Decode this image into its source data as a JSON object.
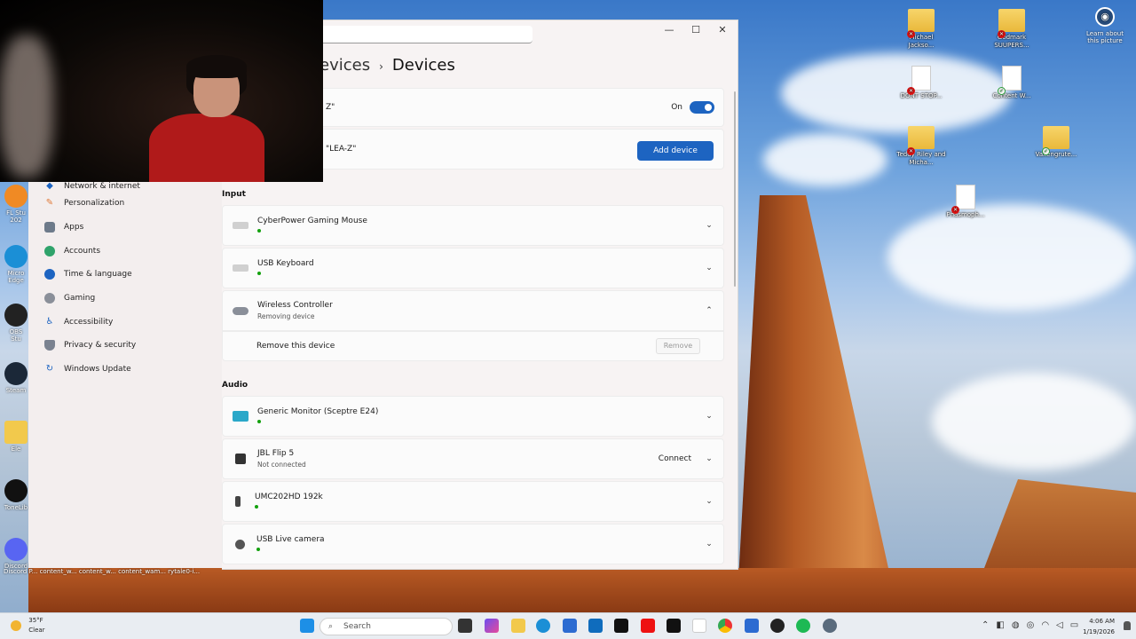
{
  "desktop": {
    "icons": [
      {
        "label": "Michael Jackso...",
        "type": "folder",
        "status": "x"
      },
      {
        "label": "Godmark SUUPERS...",
        "type": "folder",
        "status": "x"
      },
      {
        "label": "DONT STOP...",
        "type": "file",
        "status": "x"
      },
      {
        "label": "Content W...",
        "type": "file",
        "status": "ok"
      },
      {
        "label": "Teddy Riley and Micha...",
        "type": "folder",
        "status": "x"
      },
      {
        "label": "Vaxengrute...",
        "type": "folder",
        "status": "ok"
      },
      {
        "label": "Phasmoph...",
        "type": "file",
        "status": "x"
      }
    ],
    "spotlight_label": "Learn about this picture",
    "left_shortcuts": [
      "FL Stu 202",
      "Micro Edge",
      "OBS Stu",
      "Steam",
      "Ele",
      "ToneLib",
      "Discord"
    ],
    "bottom_labels": "Discord P... content_w... content_w... content_wam... rytale0-i..."
  },
  "settings": {
    "breadcrumb_prev": "evices",
    "breadcrumb_sep": "›",
    "breadcrumb_current": "Devices",
    "window_controls": [
      "—",
      "☐",
      "✕"
    ],
    "bluetooth_row": {
      "subtitle": "Z\"",
      "toggle_label": "On"
    },
    "add_row": {
      "subtitle": "\"LEA-Z\"",
      "button": "Add device"
    },
    "sections": [
      {
        "title": "Input",
        "devices": [
          {
            "name": "CyberPower Gaming Mouse",
            "status": "",
            "icon": "keyboard-icon"
          },
          {
            "name": "USB Keyboard",
            "status": "",
            "icon": "keyboard-icon"
          },
          {
            "name": "Wireless Controller",
            "status": "Removing device",
            "icon": "gamepad-icon",
            "expanded": true
          }
        ]
      },
      {
        "title": "Audio",
        "devices": [
          {
            "name": "Generic Monitor (Sceptre E24)",
            "status": "",
            "icon": "monitor-icon"
          },
          {
            "name": "JBL Flip 5",
            "status": "Not connected",
            "icon": "speaker-icon",
            "action": "Connect"
          },
          {
            "name": "UMC202HD 192k",
            "status": "",
            "icon": "speaker-icon"
          },
          {
            "name": "USB Live camera",
            "status": "",
            "icon": "webcam-icon"
          }
        ]
      }
    ],
    "remove_row": {
      "label": "Remove this device",
      "button": "Remove"
    }
  },
  "sidebar": {
    "items": [
      {
        "label": "Network & internet",
        "icon": "wifi-icon"
      },
      {
        "label": "Personalization",
        "icon": "brush-icon"
      },
      {
        "label": "Apps",
        "icon": "apps-icon"
      },
      {
        "label": "Accounts",
        "icon": "account-icon"
      },
      {
        "label": "Time & language",
        "icon": "globe-icon"
      },
      {
        "label": "Gaming",
        "icon": "gamepad-icon"
      },
      {
        "label": "Accessibility",
        "icon": "accessibility-icon"
      },
      {
        "label": "Privacy & security",
        "icon": "shield-icon"
      },
      {
        "label": "Windows Update",
        "icon": "update-icon"
      }
    ]
  },
  "taskbar": {
    "weather_temp": "35°F",
    "weather_cond": "Clear",
    "search_placeholder": "Search",
    "time": "4:06 AM",
    "date": "1/19/2026"
  },
  "colors": {
    "accent": "#1d64c1",
    "status_green": "#13a10e"
  }
}
